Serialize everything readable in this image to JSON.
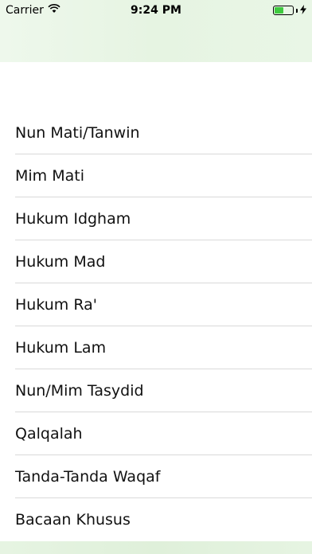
{
  "status_bar": {
    "carrier": "Carrier",
    "time": "9:24 PM",
    "battery_level": 0.5
  },
  "list": {
    "items": [
      {
        "label": "Nun Mati/Tanwin"
      },
      {
        "label": "Mim Mati"
      },
      {
        "label": "Hukum Idgham"
      },
      {
        "label": "Hukum Mad"
      },
      {
        "label": "Hukum Ra'"
      },
      {
        "label": "Hukum Lam"
      },
      {
        "label": "Nun/Mim Tasydid"
      },
      {
        "label": "Qalqalah"
      },
      {
        "label": "Tanda-Tanda Waqaf"
      },
      {
        "label": "Bacaan Khusus"
      }
    ]
  },
  "colors": {
    "battery_fill": "#3fca3f",
    "nav_tint": "#e6f4e2"
  },
  "icons": {
    "wifi": "wifi-icon",
    "battery": "battery-icon",
    "charge": "charging-bolt-icon"
  }
}
